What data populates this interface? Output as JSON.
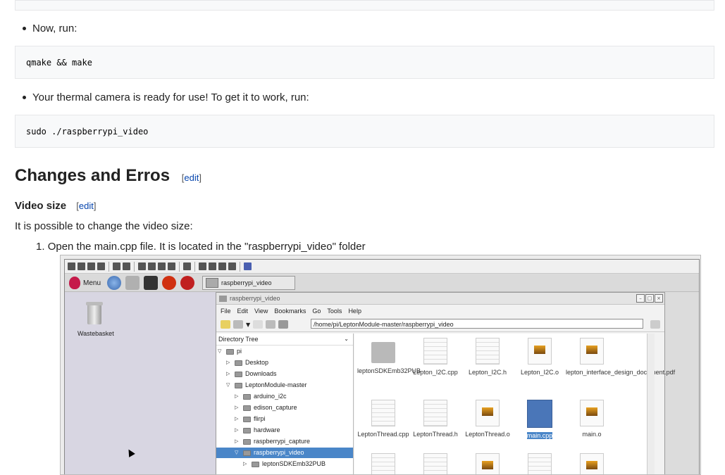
{
  "steps_top": {
    "bullet1": "Now, run:",
    "code1": "qmake && make",
    "bullet2": "Your thermal camera is ready for use! To get it to work, run:",
    "code2": "sudo ./raspberrypi_video"
  },
  "section": {
    "title": "Changes and Erros",
    "edit_label": "edit",
    "subsection_title": "Video size",
    "subsection_edit_label": "edit",
    "intro": "It is possible to change the video size:",
    "step1_number": "1.",
    "step1": "Open the main.cpp file. It is located in the \"raspberrypi_video\" folder"
  },
  "screenshot": {
    "menu_label": "Menu",
    "task_label": "raspberrypi_video",
    "desktop_icon": "Wastebasket",
    "window_title": "raspberrypi_video",
    "menus": [
      "File",
      "Edit",
      "View",
      "Bookmarks",
      "Go",
      "Tools",
      "Help"
    ],
    "path": "/home/pi/LeptonModule-master/raspberrypi_video",
    "tree_header": "Directory Tree",
    "tree": [
      "pi",
      "Desktop",
      "Downloads",
      "LeptonModule-master",
      "arduino_i2c",
      "edison_capture",
      "flirpi",
      "hardware",
      "raspberrypi_capture",
      "raspberrypi_video",
      "leptonSDKEmb32PUB"
    ],
    "files_row1": [
      "leptonSDKEmb32PUB",
      "Lepton_I2C.cpp",
      "Lepton_I2C.h",
      "Lepton_I2C.o",
      "lepton_interface_design_document.pdf"
    ],
    "files_row2": [
      "LeptonThread.cpp",
      "LeptonThread.h",
      "LeptonThread.o",
      "main.cpp",
      "main.o"
    ]
  }
}
